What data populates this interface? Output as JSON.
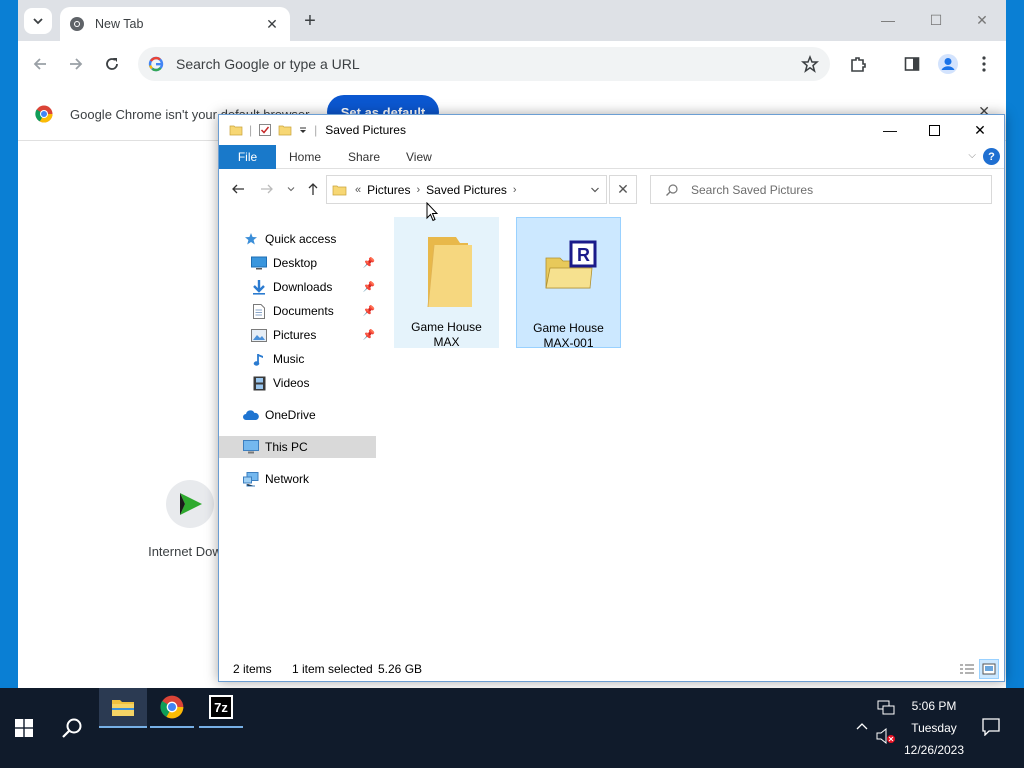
{
  "browser": {
    "tab_title": "New Tab",
    "omnibox_placeholder": "Search Google or type a URL",
    "infobar_text": "Google Chrome isn't your default browser",
    "default_button": "Set as default"
  },
  "desktop": {
    "shortcut_label": "Internet Dow..."
  },
  "explorer": {
    "title": "Saved Pictures",
    "ribbon": {
      "file": "File",
      "home": "Home",
      "share": "Share",
      "view": "View"
    },
    "address": {
      "overflow": "«",
      "crumbs": [
        "Pictures",
        "Saved Pictures"
      ]
    },
    "search_placeholder": "Search Saved Pictures",
    "nav": {
      "quick_access": "Quick access",
      "desktop": "Desktop",
      "downloads": "Downloads",
      "documents": "Documents",
      "pictures": "Pictures",
      "music": "Music",
      "videos": "Videos",
      "onedrive": "OneDrive",
      "this_pc": "This PC",
      "network": "Network"
    },
    "files": [
      {
        "line1": "Game House",
        "line2": "MAX"
      },
      {
        "line1": "Game House",
        "line2": "MAX-001"
      }
    ],
    "status": {
      "items": "2 items",
      "selected": "1 item selected",
      "size": "5.26 GB"
    }
  },
  "taskbar": {
    "time": "5:06 PM",
    "day": "Tuesday",
    "date": "12/26/2023",
    "app_7z_label": "7z"
  },
  "colors": {
    "accent": "#1979ca",
    "chrome_button": "#0b57d0",
    "taskbar": "#101b2b",
    "selection": "#cce8ff"
  }
}
